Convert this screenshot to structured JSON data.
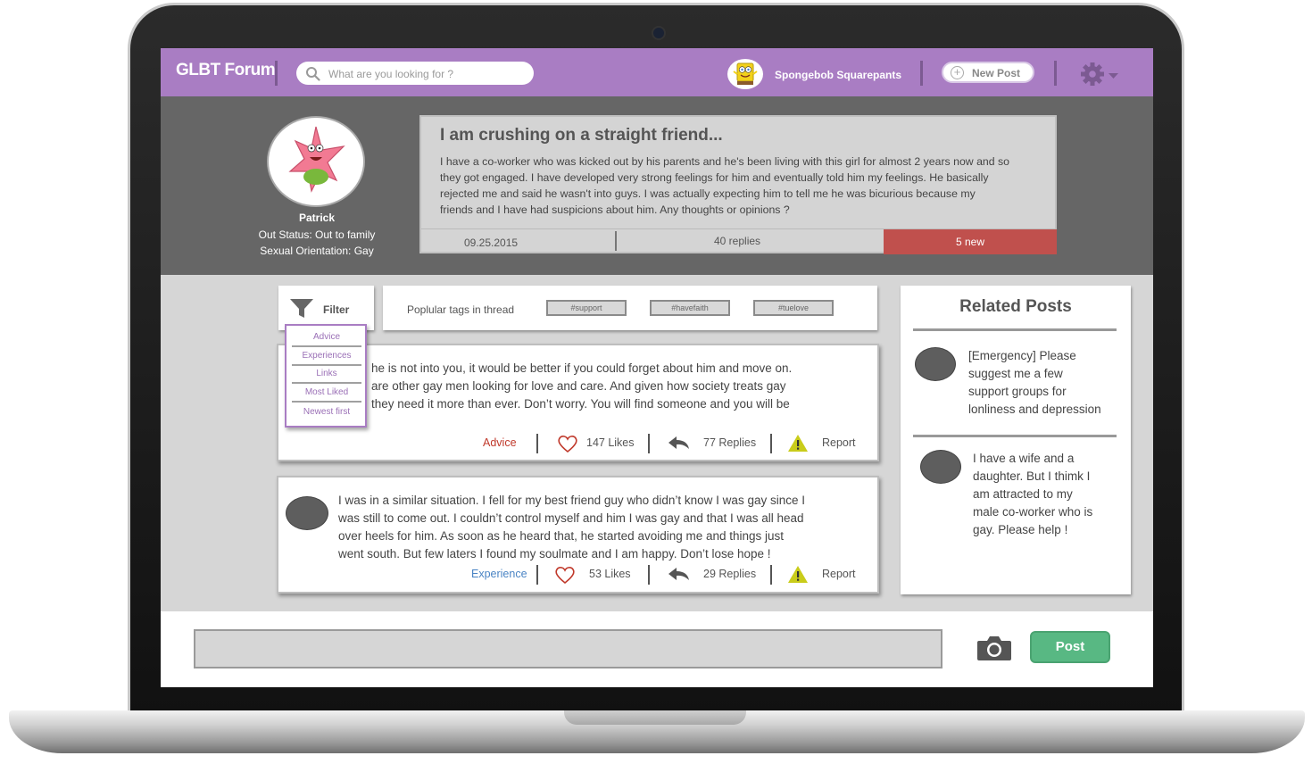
{
  "app": {
    "brand": "GLBT Forum"
  },
  "search": {
    "placeholder": "What are you looking for ?"
  },
  "user": {
    "name": "Spongebob Squarepants"
  },
  "toolbar": {
    "new_post_label": "New Post"
  },
  "profile": {
    "name": "Patrick",
    "out_status": "Out Status: Out to family",
    "orientation": "Sexual Orientation: Gay"
  },
  "thread": {
    "title": "I am crushing on a straight friend...",
    "body": "I have a co-worker who was kicked out by his parents and he's been living with this girl for almost 2 years now and so they got engaged. I have developed very strong feelings for him and eventually told him my feelings. He basically rejected me and said he wasn't into guys. I was actually expecting him to tell me he was bicurious because my friends and I have had suspicions about him. Any thoughts or opinions ?",
    "date": "09.25.2015",
    "replies": "40 replies",
    "new_count": "5 new"
  },
  "filter": {
    "label": "Filter",
    "options": [
      "Advice",
      "Experiences",
      "Links",
      "Most Liked",
      "Newest first"
    ]
  },
  "tags": {
    "label": "Poplular tags in thread",
    "items": [
      "#support",
      "#havefaith",
      "#tuelove"
    ]
  },
  "comments": [
    {
      "lines": [
        "he is not into you, it would be better if you could forget about him and move on.",
        "are other gay men looking for love and care. And given how society treats gay",
        "they need it more than ever. Don’t worry. You will find someone and you will be"
      ],
      "category": "Advice",
      "category_color": "#c0392b",
      "likes": "147 Likes",
      "replies": "77 Replies",
      "report": "Report"
    },
    {
      "lines": [
        "I was in a similar situation. I fell for my best friend guy who didn’t know I was gay since I",
        "was still to come out. I couldn’t control myself and  him I was gay and that I was all head",
        "over heels for him. As soon as he heard that, he started avoiding me and things just",
        "went south. But few laters I found my soulmate and I am happy. Don’t lose hope !"
      ],
      "category": "Experience",
      "category_color": "#4a84c4",
      "likes": "53 Likes",
      "replies": "29 Replies",
      "report": "Report"
    }
  ],
  "related": {
    "title": "Related Posts",
    "posts": [
      {
        "lines": [
          "[Emergency] Please",
          "suggest me a few",
          "support groups for",
          "lonliness and depression"
        ]
      },
      {
        "lines": [
          "I have a wife and a",
          "daughter. But I thimk I",
          "am attracted to my",
          "male co-worker who is",
          "gay. Please help !"
        ]
      }
    ]
  },
  "composer": {
    "post_label": "Post"
  },
  "colors": {
    "accent": "#a97dc3",
    "header_bg": "#666666",
    "new_badge": "#c0504d",
    "post_button": "#58b883",
    "warning_icon": "#c9cc1a",
    "heart_icon": "#c0392b"
  }
}
